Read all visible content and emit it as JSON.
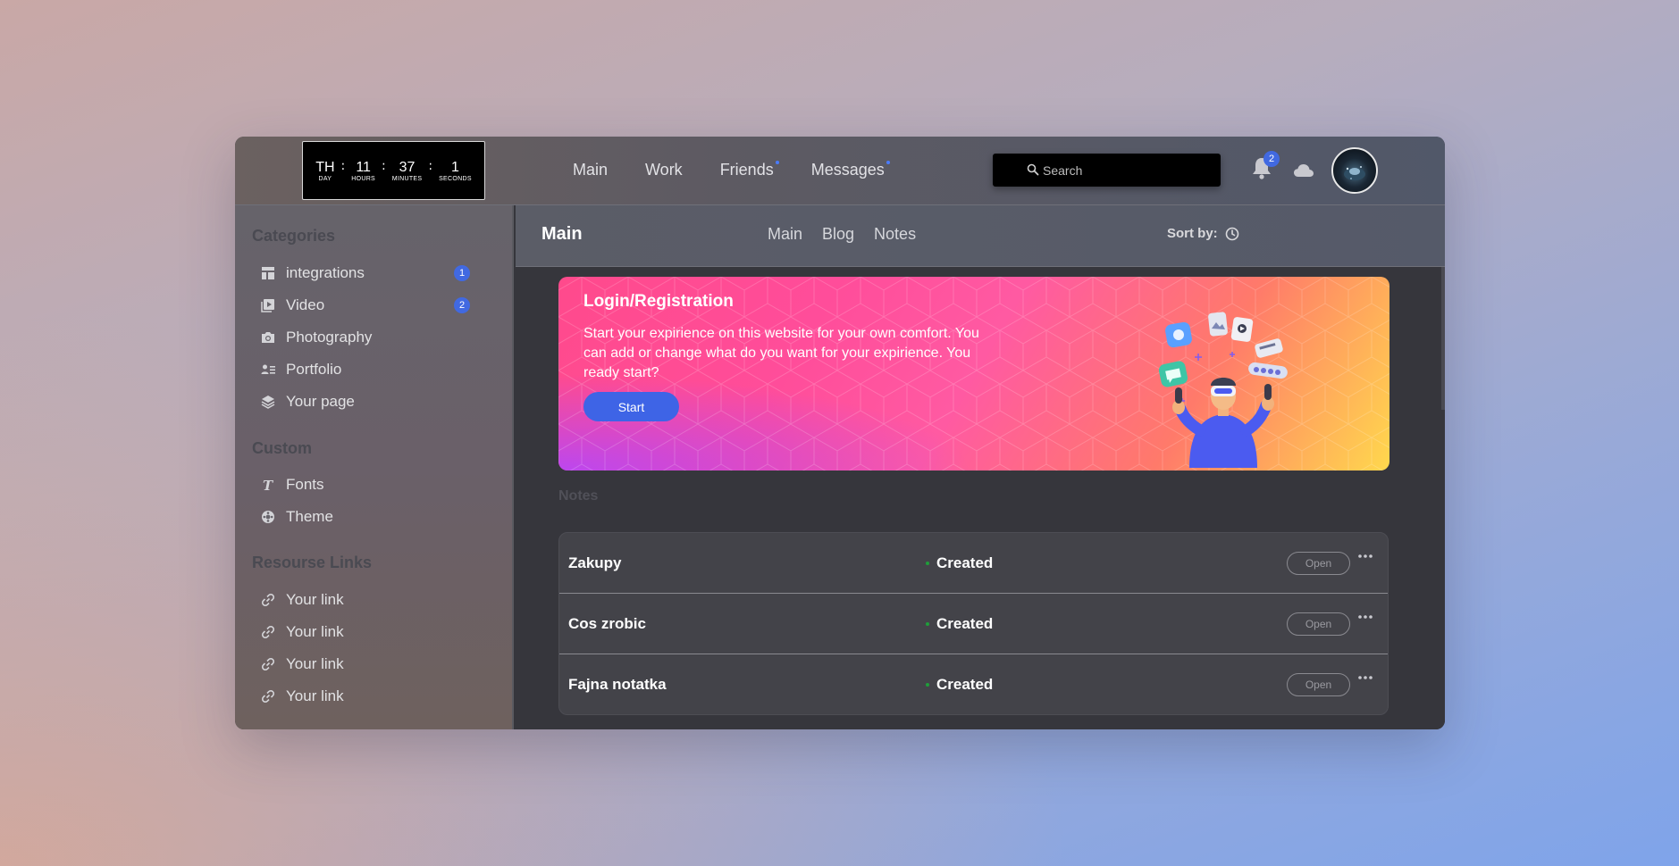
{
  "clock": {
    "day": {
      "value": "TH",
      "label": "DAY"
    },
    "hours": {
      "value": "11",
      "label": "HOURS"
    },
    "minutes": {
      "value": "37",
      "label": "MINUTES"
    },
    "seconds": {
      "value": "1",
      "label": "SECONDS"
    },
    "separator": ":"
  },
  "nav": {
    "items": [
      {
        "label": "Main",
        "has_dot": false
      },
      {
        "label": "Work",
        "has_dot": false
      },
      {
        "label": "Friends",
        "has_dot": true
      },
      {
        "label": "Messages",
        "has_dot": true
      }
    ]
  },
  "search": {
    "placeholder": "Search",
    "value": ""
  },
  "notifications": {
    "count": "2",
    "icon": "bell-icon"
  },
  "cloud": {
    "icon": "cloud-icon"
  },
  "sidebar": {
    "sections": [
      {
        "heading": "Categories",
        "items": [
          {
            "label": "integrations",
            "icon": "dashboard-icon",
            "badge": "1"
          },
          {
            "label": "Video",
            "icon": "video-library-icon",
            "badge": "2"
          },
          {
            "label": "Photography",
            "icon": "camera-icon",
            "badge": ""
          },
          {
            "label": "Portfolio",
            "icon": "contact-list-icon",
            "badge": ""
          },
          {
            "label": "Your page",
            "icon": "layers-icon",
            "badge": ""
          }
        ]
      },
      {
        "heading": "Custom",
        "items": [
          {
            "label": "Fonts",
            "icon": "font-icon",
            "badge": ""
          },
          {
            "label": "Theme",
            "icon": "palette-icon",
            "badge": ""
          }
        ]
      },
      {
        "heading": "Resourse Links",
        "items": [
          {
            "label": "Your link",
            "icon": "link-icon",
            "badge": ""
          },
          {
            "label": "Your link",
            "icon": "link-icon",
            "badge": ""
          },
          {
            "label": "Your link",
            "icon": "link-icon",
            "badge": ""
          },
          {
            "label": "Your link",
            "icon": "link-icon",
            "badge": ""
          }
        ]
      }
    ]
  },
  "main": {
    "title": "Main",
    "tabs": [
      "Main",
      "Blog",
      "Notes"
    ],
    "sort_label": "Sort by:",
    "banner": {
      "title": "Login/Registration",
      "text": "Start your expirience on this website for your own comfort. You can add or change what do you want for your expirience. You ready start?",
      "button": "Start"
    },
    "notes_heading": "Notes",
    "notes": [
      {
        "title": "Zakupy",
        "status": "Created",
        "action": "Open"
      },
      {
        "title": "Cos zrobic",
        "status": "Created",
        "action": "Open"
      },
      {
        "title": "Fajna notatka",
        "status": "Created",
        "action": "Open"
      }
    ]
  },
  "colors": {
    "accent": "#4169e1",
    "status_created": "#1f9e3a"
  }
}
